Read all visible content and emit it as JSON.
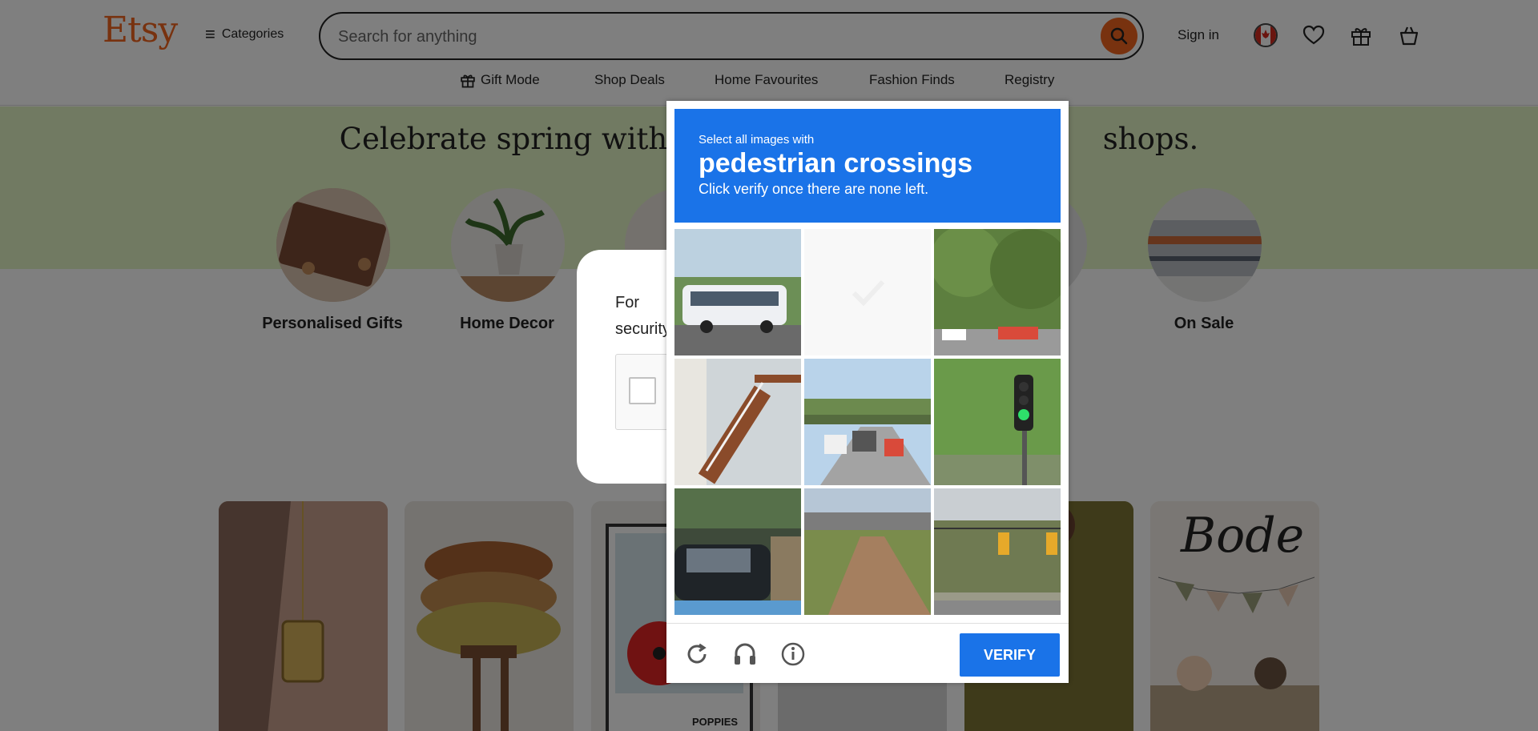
{
  "header": {
    "logo": "Etsy",
    "categories_label": "Categories",
    "search_placeholder": "Search for anything",
    "sign_in": "Sign in"
  },
  "nav": {
    "items": [
      {
        "label": "Gift Mode",
        "icon": "gift-icon"
      },
      {
        "label": "Shop Deals"
      },
      {
        "label": "Home Favourites"
      },
      {
        "label": "Fashion Finds"
      },
      {
        "label": "Registry"
      }
    ]
  },
  "banner": {
    "title_left": "Celebrate spring with",
    "title_right": "shops."
  },
  "circles": [
    {
      "label": "Personalised Gifts"
    },
    {
      "label": "Home Decor"
    },
    {
      "label": "On Sale"
    }
  ],
  "cards": {
    "poppies_label": "POPPIES",
    "bode_label": "Bode"
  },
  "dialog": {
    "text": "For security purposes, we need to know you"
  },
  "captcha": {
    "instruction_line1": "Select all images with",
    "target": "pedestrian crossings",
    "instruction_line3": "Click verify once there are none left.",
    "verify_label": "VERIFY",
    "tiles": [
      "bus-on-road",
      "blank-faded",
      "street-trees-cars",
      "wooden-stairs",
      "highway-overpass",
      "traffic-light-green",
      "parked-car-house",
      "road-under-bridge",
      "traffic-lights-trees"
    ]
  },
  "colors": {
    "brand": "#f1641e",
    "banner": "#e3f4c5",
    "captcha_blue": "#1a73e8"
  }
}
